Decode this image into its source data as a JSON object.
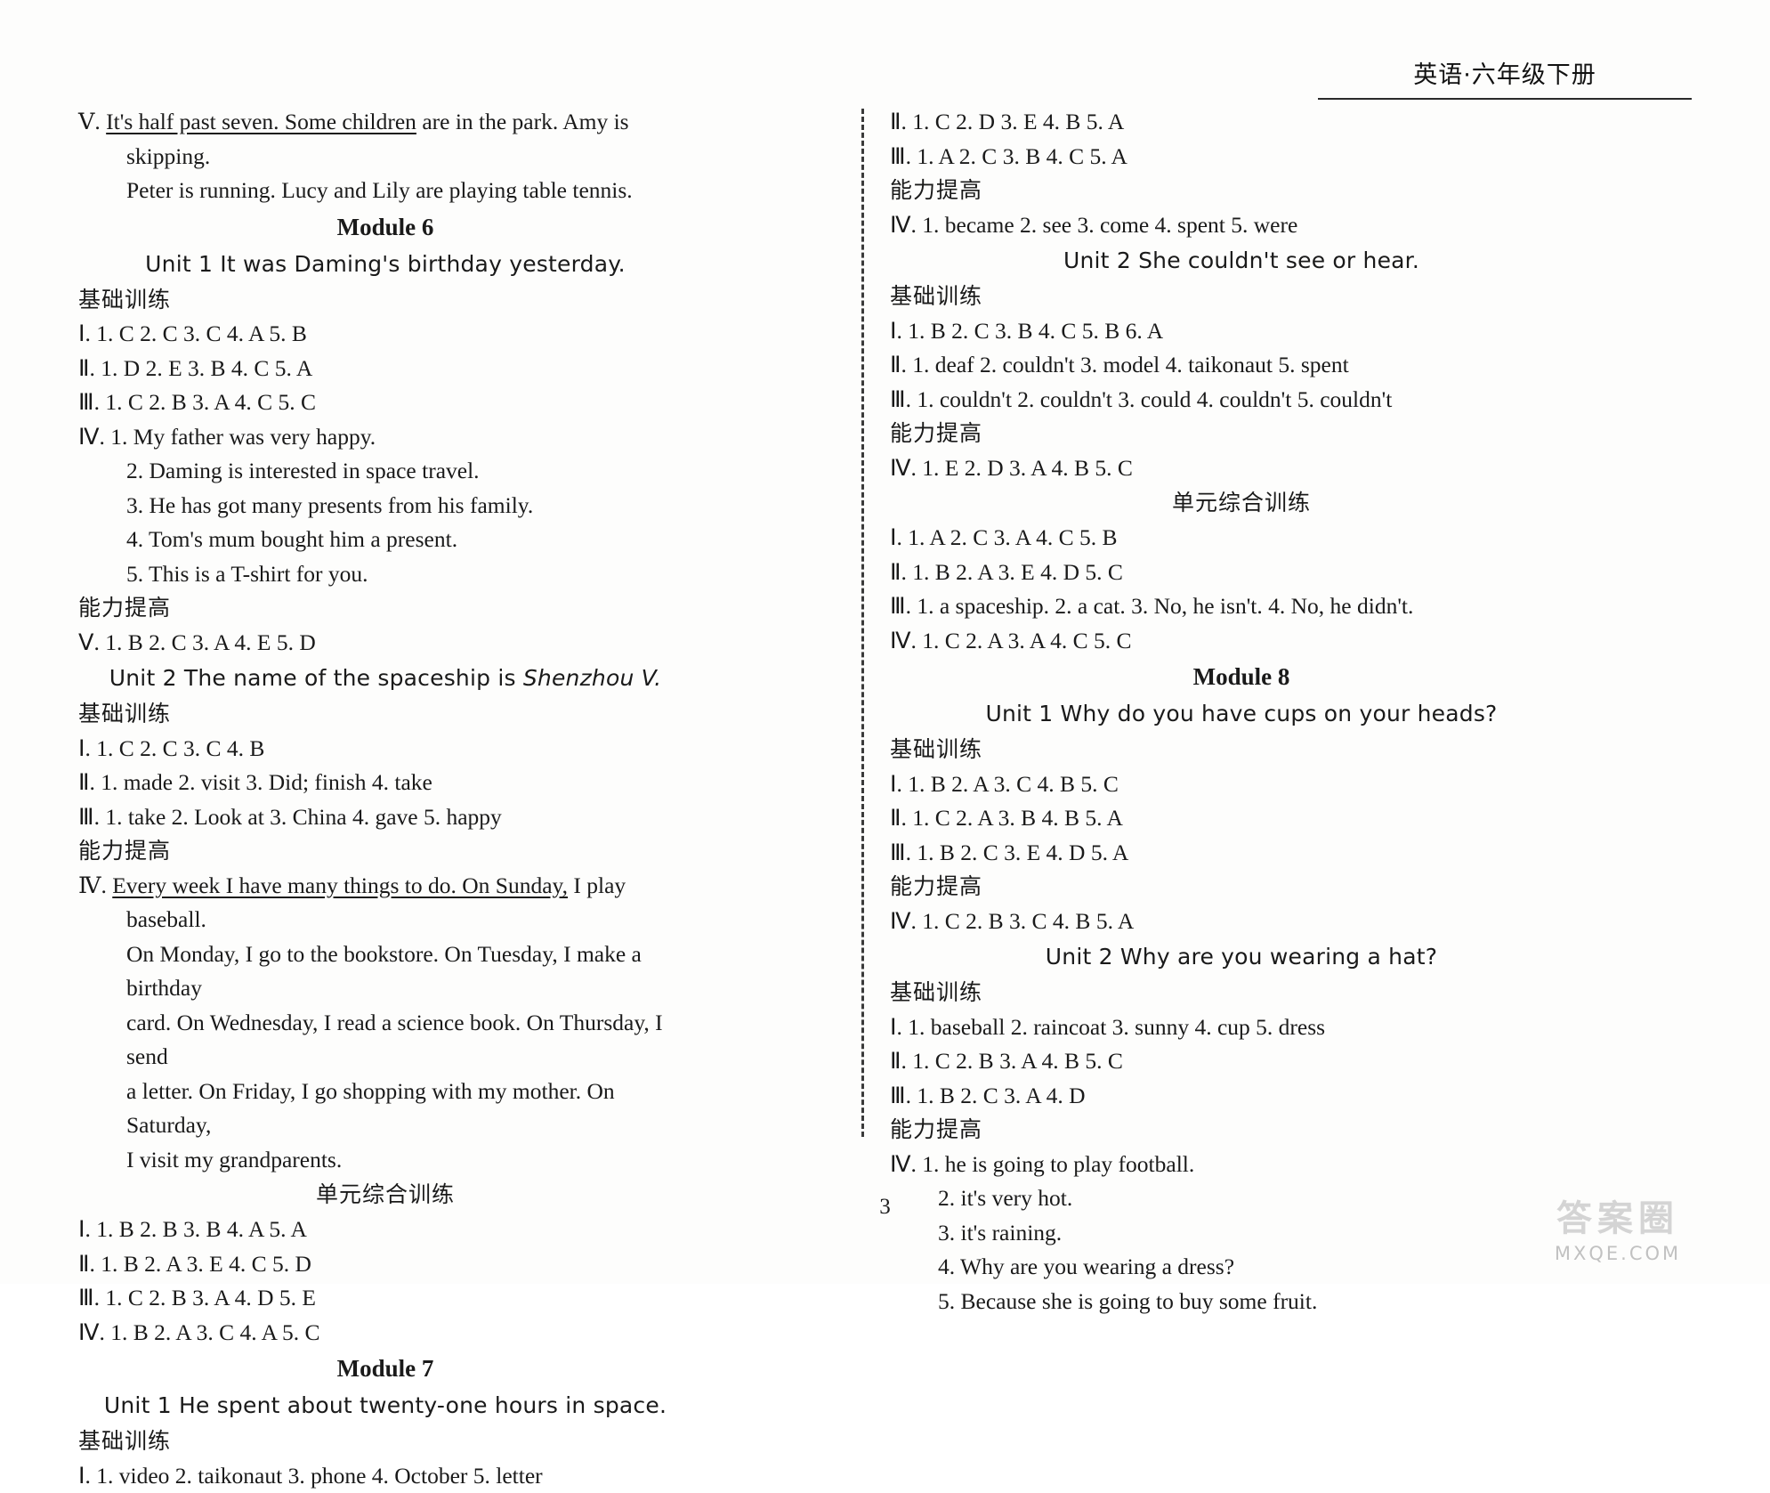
{
  "header": {
    "title": "英语·六年级下册"
  },
  "page_number": "3",
  "watermark": {
    "badge": "答案圈",
    "sub": "MXQE.COM"
  },
  "left_column": [
    {
      "kind": "para",
      "data-name": "answer-paragraph-V",
      "marker": "Ⅴ.",
      "underlined": "It's half past seven. Some children",
      "rest": " are in the park. Amy is skipping.",
      "line2": "Peter is running. Lucy and Lily are playing table tennis."
    },
    {
      "kind": "module",
      "data-name": "module-6-heading",
      "text": "Module 6"
    },
    {
      "kind": "unit",
      "data-name": "m6-unit1-heading",
      "text": "Unit 1   It was Daming's birthday yesterday."
    },
    {
      "kind": "cn",
      "data-name": "basic-training-label",
      "text": "基础训练"
    },
    {
      "kind": "ans",
      "data-name": "answer-row",
      "text": "Ⅰ. 1. C  2. C  3. C  4. A  5. B"
    },
    {
      "kind": "ans",
      "data-name": "answer-row",
      "text": "Ⅱ. 1. D  2. E  3. B  4. C  5. A"
    },
    {
      "kind": "ans",
      "data-name": "answer-row",
      "text": "Ⅲ. 1. C  2. B  3. A  4. C  5. C"
    },
    {
      "kind": "ans",
      "data-name": "answer-row",
      "text": "Ⅳ. 1. My father was very happy."
    },
    {
      "kind": "sub",
      "data-name": "answer-subrow",
      "text": "2. Daming is interested in space travel."
    },
    {
      "kind": "sub",
      "data-name": "answer-subrow",
      "text": "3. He has got many presents from his family."
    },
    {
      "kind": "sub",
      "data-name": "answer-subrow",
      "text": "4. Tom's mum bought him a present."
    },
    {
      "kind": "sub",
      "data-name": "answer-subrow",
      "text": "5. This is a T-shirt for you."
    },
    {
      "kind": "cn",
      "data-name": "ability-improvement-label",
      "text": "能力提高"
    },
    {
      "kind": "ans",
      "data-name": "answer-row",
      "text": "Ⅴ. 1. B  2. C  3. A  4. E  5. D"
    },
    {
      "kind": "unit",
      "data-name": "m6-unit2-heading",
      "text": "Unit 2   The name of the spaceship is ",
      "italic": "Shenzhou V."
    },
    {
      "kind": "cn",
      "data-name": "basic-training-label",
      "text": "基础训练"
    },
    {
      "kind": "ans",
      "data-name": "answer-row",
      "text": "Ⅰ. 1. C  2. C  3. C  4. B"
    },
    {
      "kind": "ans",
      "data-name": "answer-row",
      "text": "Ⅱ. 1. made  2. visit  3. Did; finish  4. take"
    },
    {
      "kind": "ans",
      "data-name": "answer-row",
      "text": "Ⅲ. 1. take  2. Look at  3. China  4. gave  5. happy"
    },
    {
      "kind": "cn",
      "data-name": "ability-improvement-label",
      "text": "能力提高"
    },
    {
      "kind": "para",
      "data-name": "answer-paragraph-IV",
      "marker": "Ⅳ.",
      "underlined": "Every week I have many things to do. On Sunday,",
      "rest": " I play baseball.",
      "line2": "On Monday, I go to the bookstore. On Tuesday, I make a birthday",
      "line3": "card. On Wednesday, I read a science book. On Thursday, I send",
      "line4": "a letter. On Friday, I go shopping with my mother. On Saturday,",
      "line5": "I visit my grandparents."
    },
    {
      "kind": "center-cn",
      "data-name": "comprehensive-training-label",
      "text": "单元综合训练"
    },
    {
      "kind": "ans",
      "data-name": "answer-row",
      "text": "Ⅰ. 1. B  2. B  3. B  4. A  5. A"
    },
    {
      "kind": "ans",
      "data-name": "answer-row",
      "text": "Ⅱ. 1. B  2. A  3. E  4. C  5. D"
    },
    {
      "kind": "ans",
      "data-name": "answer-row",
      "text": "Ⅲ. 1. C  2. B  3. A  4. D  5. E"
    },
    {
      "kind": "ans",
      "data-name": "answer-row",
      "text": "Ⅳ. 1. B  2. A  3. C  4. A  5. C"
    },
    {
      "kind": "module",
      "data-name": "module-7-heading",
      "text": "Module 7"
    },
    {
      "kind": "unit",
      "data-name": "m7-unit1-heading",
      "text": "Unit 1   He spent about twenty-one hours in space."
    },
    {
      "kind": "cn",
      "data-name": "basic-training-label",
      "text": "基础训练"
    },
    {
      "kind": "ans",
      "data-name": "answer-row",
      "text": "Ⅰ. 1. video  2. taikonaut  3. phone  4. October  5. letter"
    }
  ],
  "right_column": [
    {
      "kind": "ans",
      "data-name": "answer-row",
      "text": "Ⅱ. 1. C  2. D  3. E  4. B  5. A"
    },
    {
      "kind": "ans",
      "data-name": "answer-row",
      "text": "Ⅲ. 1. A  2. C  3. B  4. C  5. A"
    },
    {
      "kind": "cn",
      "data-name": "ability-improvement-label",
      "text": "能力提高"
    },
    {
      "kind": "ans",
      "data-name": "answer-row",
      "text": "Ⅳ. 1. became  2. see  3. come  4. spent  5. were"
    },
    {
      "kind": "unit",
      "data-name": "m7-unit2-heading",
      "text": "Unit 2   She couldn't see or hear."
    },
    {
      "kind": "cn",
      "data-name": "basic-training-label",
      "text": "基础训练"
    },
    {
      "kind": "ans",
      "data-name": "answer-row",
      "text": "Ⅰ. 1. B  2. C  3. B  4. C  5. B  6. A"
    },
    {
      "kind": "ans",
      "data-name": "answer-row",
      "text": "Ⅱ. 1. deaf  2. couldn't  3. model  4. taikonaut  5. spent"
    },
    {
      "kind": "ans",
      "data-name": "answer-row",
      "text": "Ⅲ. 1. couldn't  2. couldn't  3. could  4. couldn't  5. couldn't"
    },
    {
      "kind": "cn",
      "data-name": "ability-improvement-label",
      "text": "能力提高"
    },
    {
      "kind": "ans",
      "data-name": "answer-row",
      "text": "Ⅳ. 1. E  2. D  3. A  4. B  5. C"
    },
    {
      "kind": "center-cn",
      "data-name": "comprehensive-training-label",
      "text": "单元综合训练"
    },
    {
      "kind": "ans",
      "data-name": "answer-row",
      "text": "Ⅰ. 1. A  2. C  3. A  4. C  5. B"
    },
    {
      "kind": "ans",
      "data-name": "answer-row",
      "text": "Ⅱ. 1. B  2. A  3. E  4. D  5. C"
    },
    {
      "kind": "ans",
      "data-name": "answer-row",
      "text": "Ⅲ. 1. a spaceship.  2. a cat.  3. No, he isn't.  4. No, he didn't."
    },
    {
      "kind": "ans",
      "data-name": "answer-row",
      "text": "Ⅳ. 1. C  2. A  3. A  4. C  5. C"
    },
    {
      "kind": "module",
      "data-name": "module-8-heading",
      "text": "Module 8"
    },
    {
      "kind": "unit",
      "data-name": "m8-unit1-heading",
      "text": "Unit 1   Why do you have cups on your heads?"
    },
    {
      "kind": "cn",
      "data-name": "basic-training-label",
      "text": "基础训练"
    },
    {
      "kind": "ans",
      "data-name": "answer-row",
      "text": "Ⅰ. 1. B  2. A  3. C  4. B  5. C"
    },
    {
      "kind": "ans",
      "data-name": "answer-row",
      "text": "Ⅱ. 1. C  2. A  3. B  4. B  5. A"
    },
    {
      "kind": "ans",
      "data-name": "answer-row",
      "text": "Ⅲ. 1. B  2. C  3. E  4. D  5. A"
    },
    {
      "kind": "cn",
      "data-name": "ability-improvement-label",
      "text": "能力提高"
    },
    {
      "kind": "ans",
      "data-name": "answer-row",
      "text": "Ⅳ. 1. C  2. B  3. C  4. B  5. A"
    },
    {
      "kind": "unit",
      "data-name": "m8-unit2-heading",
      "text": "Unit 2   Why are you wearing a hat?"
    },
    {
      "kind": "cn",
      "data-name": "basic-training-label",
      "text": "基础训练"
    },
    {
      "kind": "ans",
      "data-name": "answer-row",
      "text": "Ⅰ. 1. baseball  2. raincoat  3. sunny  4. cup  5. dress"
    },
    {
      "kind": "ans",
      "data-name": "answer-row",
      "text": "Ⅱ. 1. C  2. B  3. A  4. B  5. C"
    },
    {
      "kind": "ans",
      "data-name": "answer-row",
      "text": "Ⅲ. 1. B  2. C  3. A  4. D"
    },
    {
      "kind": "cn",
      "data-name": "ability-improvement-label",
      "text": "能力提高"
    },
    {
      "kind": "ans",
      "data-name": "answer-row",
      "text": "Ⅳ. 1. he is going to play football."
    },
    {
      "kind": "sub",
      "data-name": "answer-subrow",
      "text": "2. it's very hot."
    },
    {
      "kind": "sub",
      "data-name": "answer-subrow",
      "text": "3. it's raining."
    },
    {
      "kind": "sub",
      "data-name": "answer-subrow",
      "text": "4. Why are you wearing a dress?"
    },
    {
      "kind": "sub",
      "data-name": "answer-subrow",
      "text": "5. Because she is going to buy some fruit."
    }
  ]
}
